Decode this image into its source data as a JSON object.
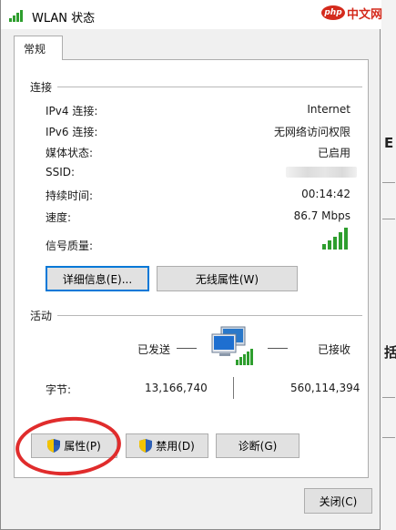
{
  "window": {
    "title": "WLAN 状态"
  },
  "watermark": {
    "logo": "php",
    "text": "中文网"
  },
  "tabs": [
    {
      "label": "常规"
    }
  ],
  "connection": {
    "section_title": "连接",
    "rows": [
      {
        "label": "IPv4 连接:",
        "value": "Internet"
      },
      {
        "label": "IPv6 连接:",
        "value": "无网络访问权限"
      },
      {
        "label": "媒体状态:",
        "value": "已启用"
      },
      {
        "label": "SSID:",
        "value": ""
      },
      {
        "label": "持续时间:",
        "value": "00:14:42"
      },
      {
        "label": "速度:",
        "value": "86.7 Mbps"
      },
      {
        "label": "信号质量:",
        "value": ""
      }
    ],
    "signal_bars": 5,
    "details_button": "详细信息(E)...",
    "wireless_button": "无线属性(W)"
  },
  "activity": {
    "section_title": "活动",
    "sent_label": "已发送",
    "received_label": "已接收",
    "bytes_label": "字节:",
    "bytes_sent": "13,166,740",
    "bytes_received": "560,114,394"
  },
  "buttons": {
    "properties": "属性(P)",
    "disable": "禁用(D)",
    "diagnose": "诊断(G)",
    "close": "关闭(C)"
  },
  "colors": {
    "annotation_ring": "#e02c2c",
    "signal": "#2e9e2e",
    "focus_border": "#0078d7"
  }
}
